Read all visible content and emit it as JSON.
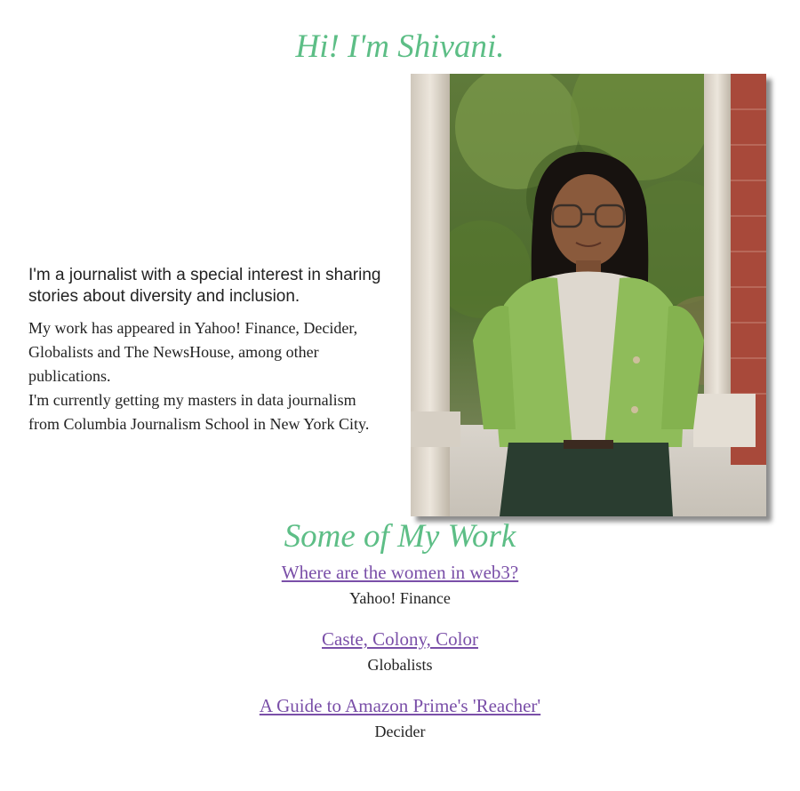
{
  "colors": {
    "accent": "#5dbe86",
    "link": "#7a4fa8"
  },
  "header": {
    "title": "Hi! I'm Shivani."
  },
  "intro": {
    "lead": "I'm a journalist with a special interest in sharing stories about diversity and inclusion.",
    "paragraphs": [
      "My work has appeared in Yahoo! Finance, Decider, Globalists and The NewsHouse, among other publications.",
      "I'm currently getting my masters in data journalism from Columbia Journalism School in New York City."
    ]
  },
  "photo": {
    "icon": "portrait-photo"
  },
  "work": {
    "title": "Some of My Work",
    "items": [
      {
        "title": "Where are the women in web3?",
        "publication": "Yahoo! Finance"
      },
      {
        "title": "Caste, Colony, Color",
        "publication": "Globalists"
      },
      {
        "title": "A Guide to Amazon Prime's 'Reacher'",
        "publication": "Decider"
      }
    ]
  }
}
